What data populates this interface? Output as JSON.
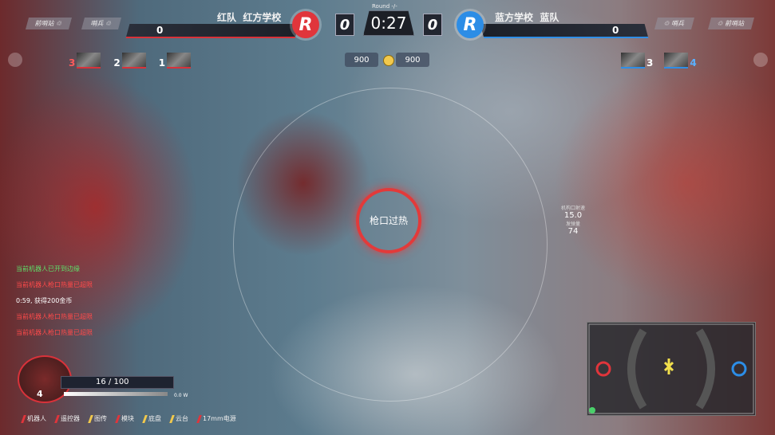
{
  "top": {
    "left_tabs": [
      "前哨站 ♲",
      "哨兵 ♲"
    ],
    "right_tabs": [
      "♲ 哨兵",
      "♲ 前哨站"
    ],
    "red_team": {
      "label": "红队",
      "school": "红方学校",
      "base_hp": "0",
      "score": "0",
      "logo_letter": "R"
    },
    "blue_team": {
      "label": "蓝队",
      "school": "蓝方学校",
      "base_hp": "0",
      "score": "0",
      "logo_letter": "R"
    },
    "round": "Round -/-",
    "timer": "0:27",
    "left_coins": "900",
    "right_coins": "900"
  },
  "left_robots": [
    {
      "number": "3"
    },
    {
      "number": "2"
    },
    {
      "number": "1"
    }
  ],
  "right_robots": [
    {
      "number": "3"
    },
    {
      "number": "4"
    }
  ],
  "crosshair": {
    "text": "枪口过热"
  },
  "stats": [
    {
      "label": "机构口射速",
      "value": "15.0"
    },
    {
      "label": "发弹量",
      "value": "74"
    }
  ],
  "messages": [
    {
      "text": "当前机器人已开到边缘",
      "color": "#5ee06a"
    },
    {
      "text": "当前机器人枪口热量已超限",
      "color": "#ff4a4a"
    },
    {
      "text": "0:59, 获得200金币",
      "color": "#ffffff"
    },
    {
      "text": "当前机器人枪口热量已超限",
      "color": "#ff4a4a"
    },
    {
      "text": "当前机器人枪口热量已超限",
      "color": "#ff4a4a"
    }
  ],
  "player": {
    "level": "4",
    "hp": "16 / 100",
    "power": "0.0 W"
  },
  "bottom_status": [
    {
      "label": "机器人",
      "color": "#e0353b"
    },
    {
      "label": "遥控器",
      "color": "#e0353b"
    },
    {
      "label": "图传",
      "color": "#f2c94c"
    },
    {
      "label": "模块",
      "color": "#e0353b"
    },
    {
      "label": "底盘",
      "color": "#f2c94c"
    },
    {
      "label": "云台",
      "color": "#f2c94c"
    },
    {
      "label": "17mm电源",
      "color": "#e0353b"
    }
  ],
  "colors": {
    "red": "#e0353b",
    "blue": "#2c8de6",
    "accent": "#f2c94c"
  }
}
